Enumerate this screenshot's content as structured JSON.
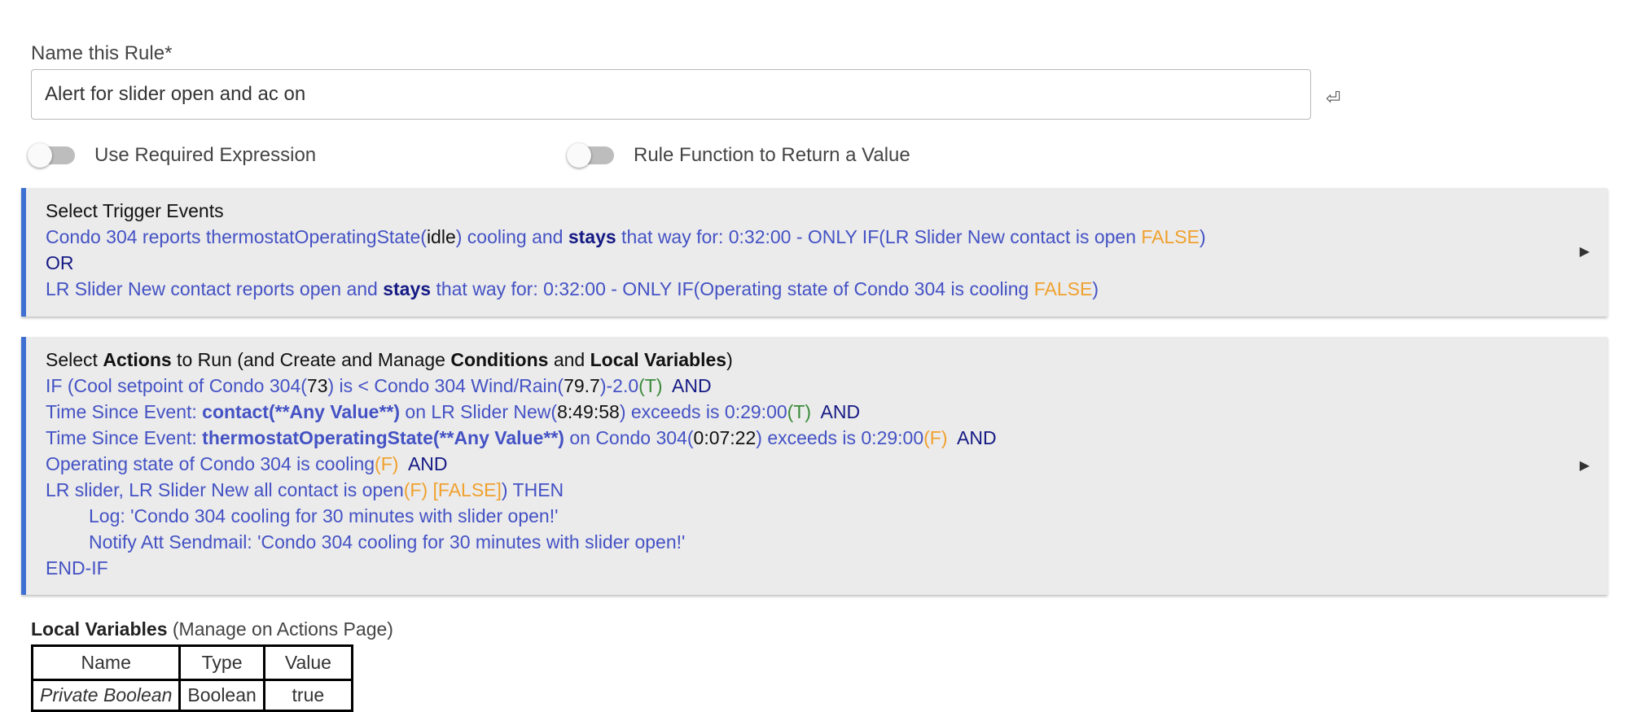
{
  "rule_name": {
    "label": "Name this Rule*",
    "value": "Alert for slider open and ac on"
  },
  "icons": {
    "enter": "enter-return-icon",
    "expand": "triangle-right-icon"
  },
  "toggles": [
    {
      "label": "Use Required Expression",
      "on": false
    },
    {
      "label": "Rule Function to Return a Value",
      "on": false
    }
  ],
  "trigger_panel": {
    "title": "Select Trigger Events",
    "t1": {
      "a": "Condo 304 reports thermostatOperatingState(",
      "b": "idle",
      "c": ") cooling and ",
      "d": "stays",
      "e": " that way for: 0:32:00 - ONLY IF(LR Slider New contact is open ",
      "f": "FALSE",
      "g": ")"
    },
    "or": "OR",
    "t2": {
      "a": "LR Slider New contact reports open and ",
      "b": "stays",
      "c": " that way for: 0:32:00 - ONLY IF(Operating state of Condo 304 is cooling ",
      "d": "FALSE",
      "e": ")"
    }
  },
  "actions_panel": {
    "title": {
      "a": "Select ",
      "b": "Actions",
      "c": " to Run (and Create and Manage ",
      "d": "Conditions",
      "e": " and ",
      "f": "Local Variables",
      "g": ")"
    },
    "l1": {
      "a": "IF (Cool setpoint of Condo 304(",
      "b": "73",
      "c": ") is < Condo 304 Wind/Rain(",
      "d": "79.7",
      "e": ")-2.0",
      "f": "(T)",
      "g": "AND"
    },
    "l2": {
      "a": "Time Since Event: ",
      "b": "contact(**Any Value**)",
      "c": " on LR Slider New(",
      "d": "8:49:58",
      "e": ") exceeds is 0:29:00",
      "f": "(T)",
      "g": "AND"
    },
    "l3": {
      "a": "Time Since Event: ",
      "b": "thermostatOperatingState(**Any Value**)",
      "c": " on Condo 304(",
      "d": "0:07:22",
      "e": ") exceeds is 0:29:00",
      "f": "(F)",
      "g": "AND"
    },
    "l4": {
      "a": "Operating state of Condo 304 is cooling",
      "b": "(F)",
      "c": "AND"
    },
    "l5": {
      "a": "LR slider, LR Slider New all contact is open",
      "b": "(F) [FALSE]",
      "c": ") THEN"
    },
    "l6": "Log: 'Condo 304 cooling for 30 minutes with slider open!'",
    "l7": "Notify Att Sendmail: 'Condo 304 cooling for 30 minutes with slider open!'",
    "l8": "END-IF"
  },
  "local_variables": {
    "heading_bold": "Local Variables",
    "heading_rest": " (Manage on Actions Page)",
    "columns": [
      "Name",
      "Type",
      "Value"
    ],
    "rows": [
      [
        "Private Boolean",
        "Boolean",
        "true"
      ]
    ]
  }
}
